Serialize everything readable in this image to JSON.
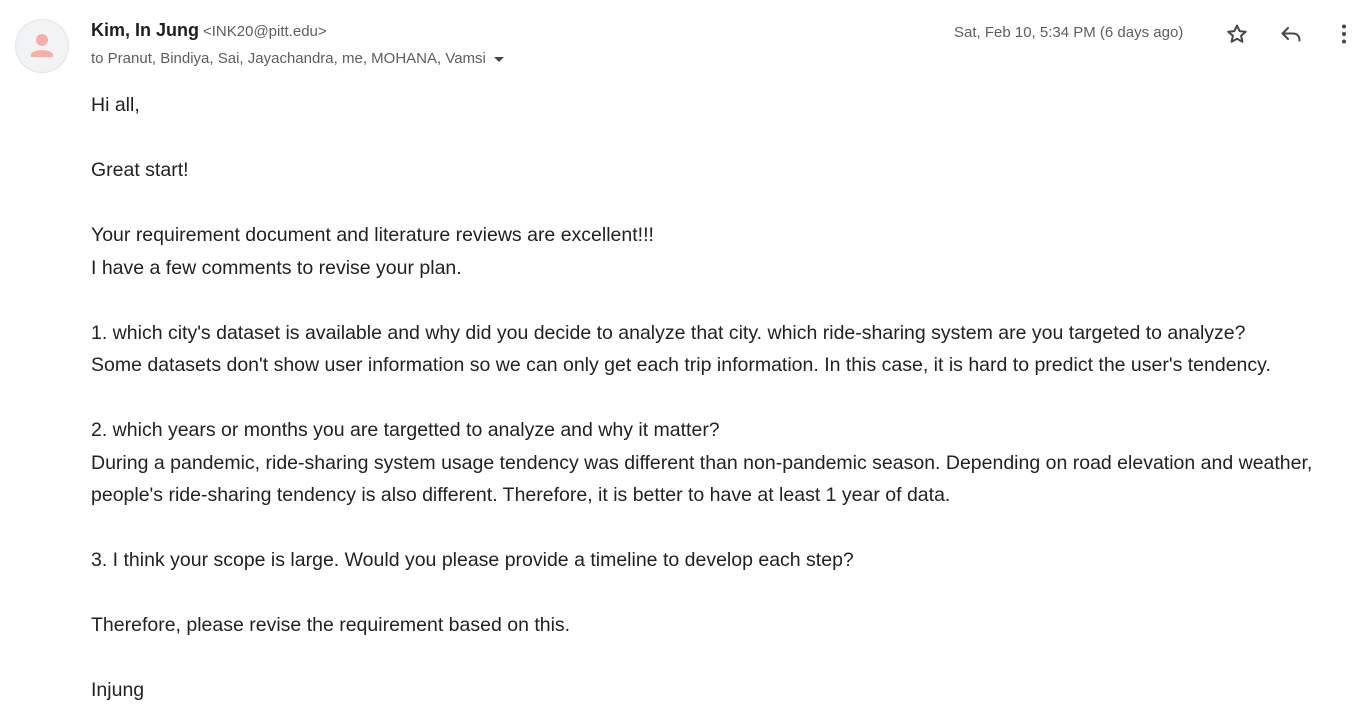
{
  "email": {
    "sender": {
      "name": "Kim, In Jung",
      "email": "<INK20@pitt.edu>",
      "avatar_icon": "person-icon",
      "avatar_color": "#f6aea9"
    },
    "recipients": "to Pranut, Bindiya, Sai, Jayachandra, me, MOHANA, Vamsi",
    "date": "Sat, Feb 10, 5:34 PM (6 days ago)",
    "actions": {
      "star_icon": "star-icon",
      "reply_icon": "reply-icon",
      "more_icon": "more-vertical-icon"
    },
    "body": {
      "greeting": "Hi all,",
      "line_great_start": "Great start!",
      "line_excellent": "Your requirement document and literature reviews are excellent!!!",
      "line_comments": "I have a few comments to revise your plan.",
      "point1_q": "1. which city's dataset is available and why did you decide to analyze that city. which ride-sharing system are you targeted to analyze?",
      "point1_note": "Some datasets don't show user information so we can only get each trip information. In this case, it is hard to predict the user's tendency.",
      "point2_q": "2. which years or months you are targetted to analyze and why it matter?",
      "point2_note": "During a pandemic, ride-sharing system usage tendency was different than non-pandemic season. Depending on road elevation and weather, people's ride-sharing tendency is also different. Therefore, it is better to have at least 1 year of data.",
      "point3": "3. I think your scope is large. Would you please provide a timeline to develop each step?",
      "closing": "Therefore, please revise the requirement based on this.",
      "signature": "Injung"
    }
  }
}
